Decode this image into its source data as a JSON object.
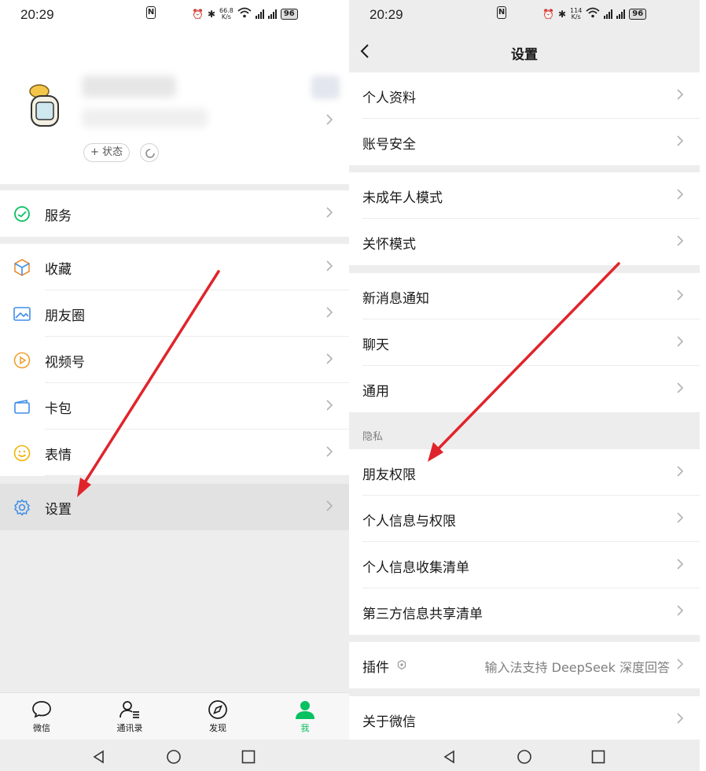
{
  "left": {
    "status_bar": {
      "time": "20:29",
      "speed_top": "66.8",
      "speed_bottom": "K/s",
      "battery": "96"
    },
    "profile": {
      "status_button": "+ 状态"
    },
    "menu": {
      "services": "服务",
      "favorites": "收藏",
      "moments": "朋友圈",
      "channels": "视频号",
      "cards": "卡包",
      "stickers": "表情",
      "settings": "设置"
    },
    "tabs": {
      "chats": "微信",
      "contacts": "通讯录",
      "discover": "发现",
      "me": "我"
    }
  },
  "right": {
    "status_bar": {
      "time": "20:29",
      "speed_top": "114",
      "speed_bottom": "K/s",
      "battery": "96"
    },
    "header": {
      "title": "设置"
    },
    "items": {
      "profile": "个人资料",
      "account_security": "账号安全",
      "minor_mode": "未成年人模式",
      "care_mode": "关怀模式",
      "notifications": "新消息通知",
      "chat": "聊天",
      "general": "通用",
      "privacy_section": "隐私",
      "friend_permissions": "朋友权限",
      "personal_info_permissions": "个人信息与权限",
      "personal_info_collection": "个人信息收集清单",
      "third_party_sharing": "第三方信息共享清单",
      "plugins": "插件",
      "plugins_desc": "输入法支持 DeepSeek 深度回答",
      "about": "关于微信"
    }
  },
  "colors": {
    "wechat_green": "#07c160",
    "annotation_red": "#e0242b",
    "background": "#ededed"
  }
}
